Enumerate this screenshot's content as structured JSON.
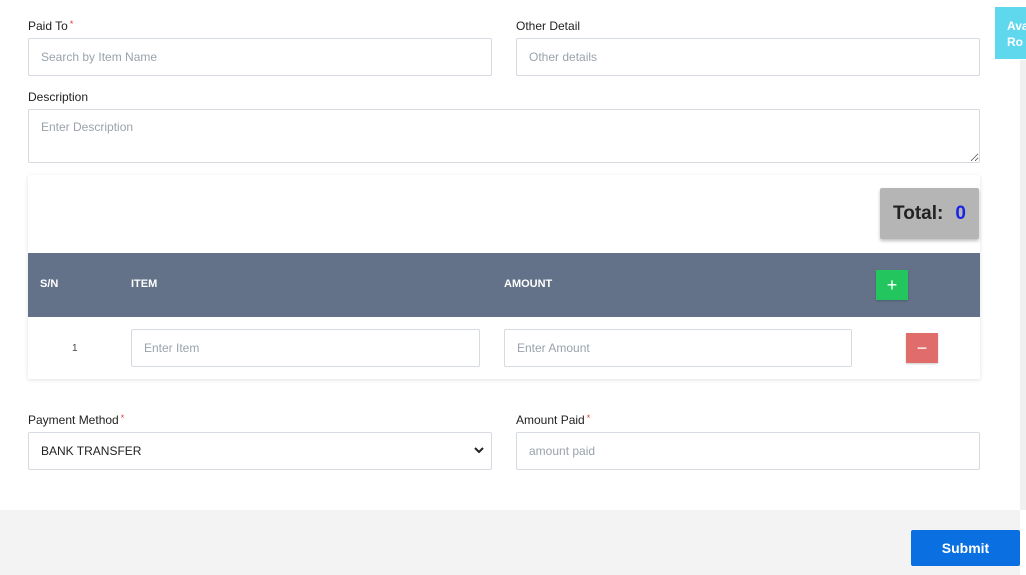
{
  "form": {
    "paid_to": {
      "label": "Paid To",
      "required_mark": "*",
      "placeholder": "Search by Item Name"
    },
    "other_detail": {
      "label": "Other Detail",
      "placeholder": "Other details"
    },
    "description": {
      "label": "Description",
      "placeholder": "Enter Description"
    }
  },
  "items_table": {
    "total_label": "Total:",
    "total_value": "0",
    "headers": {
      "sn": "S/N",
      "item": "ITEM",
      "amount": "AMOUNT"
    },
    "add_button": "+",
    "rows": [
      {
        "sn": "1",
        "item_placeholder": "Enter Item",
        "amount_placeholder": "Enter Amount",
        "remove_button": "−"
      }
    ]
  },
  "payment": {
    "method": {
      "label": "Payment Method",
      "required_mark": "*",
      "selected": "BANK TRANSFER"
    },
    "amount_paid": {
      "label": "Amount Paid",
      "required_mark": "*",
      "placeholder": "amount paid"
    }
  },
  "submit_label": "Submit",
  "side_tab": {
    "line1": "Ava",
    "line2": "Ro"
  },
  "colors": {
    "table_header": "#637288",
    "add_button": "#22c55e",
    "remove_button": "#e06c6c",
    "submit_button": "#0a6fe0",
    "total_value": "#1a24e8",
    "side_tab": "#5fd7ec"
  },
  "icons": {
    "select_arrow": "chevron-down-icon"
  }
}
